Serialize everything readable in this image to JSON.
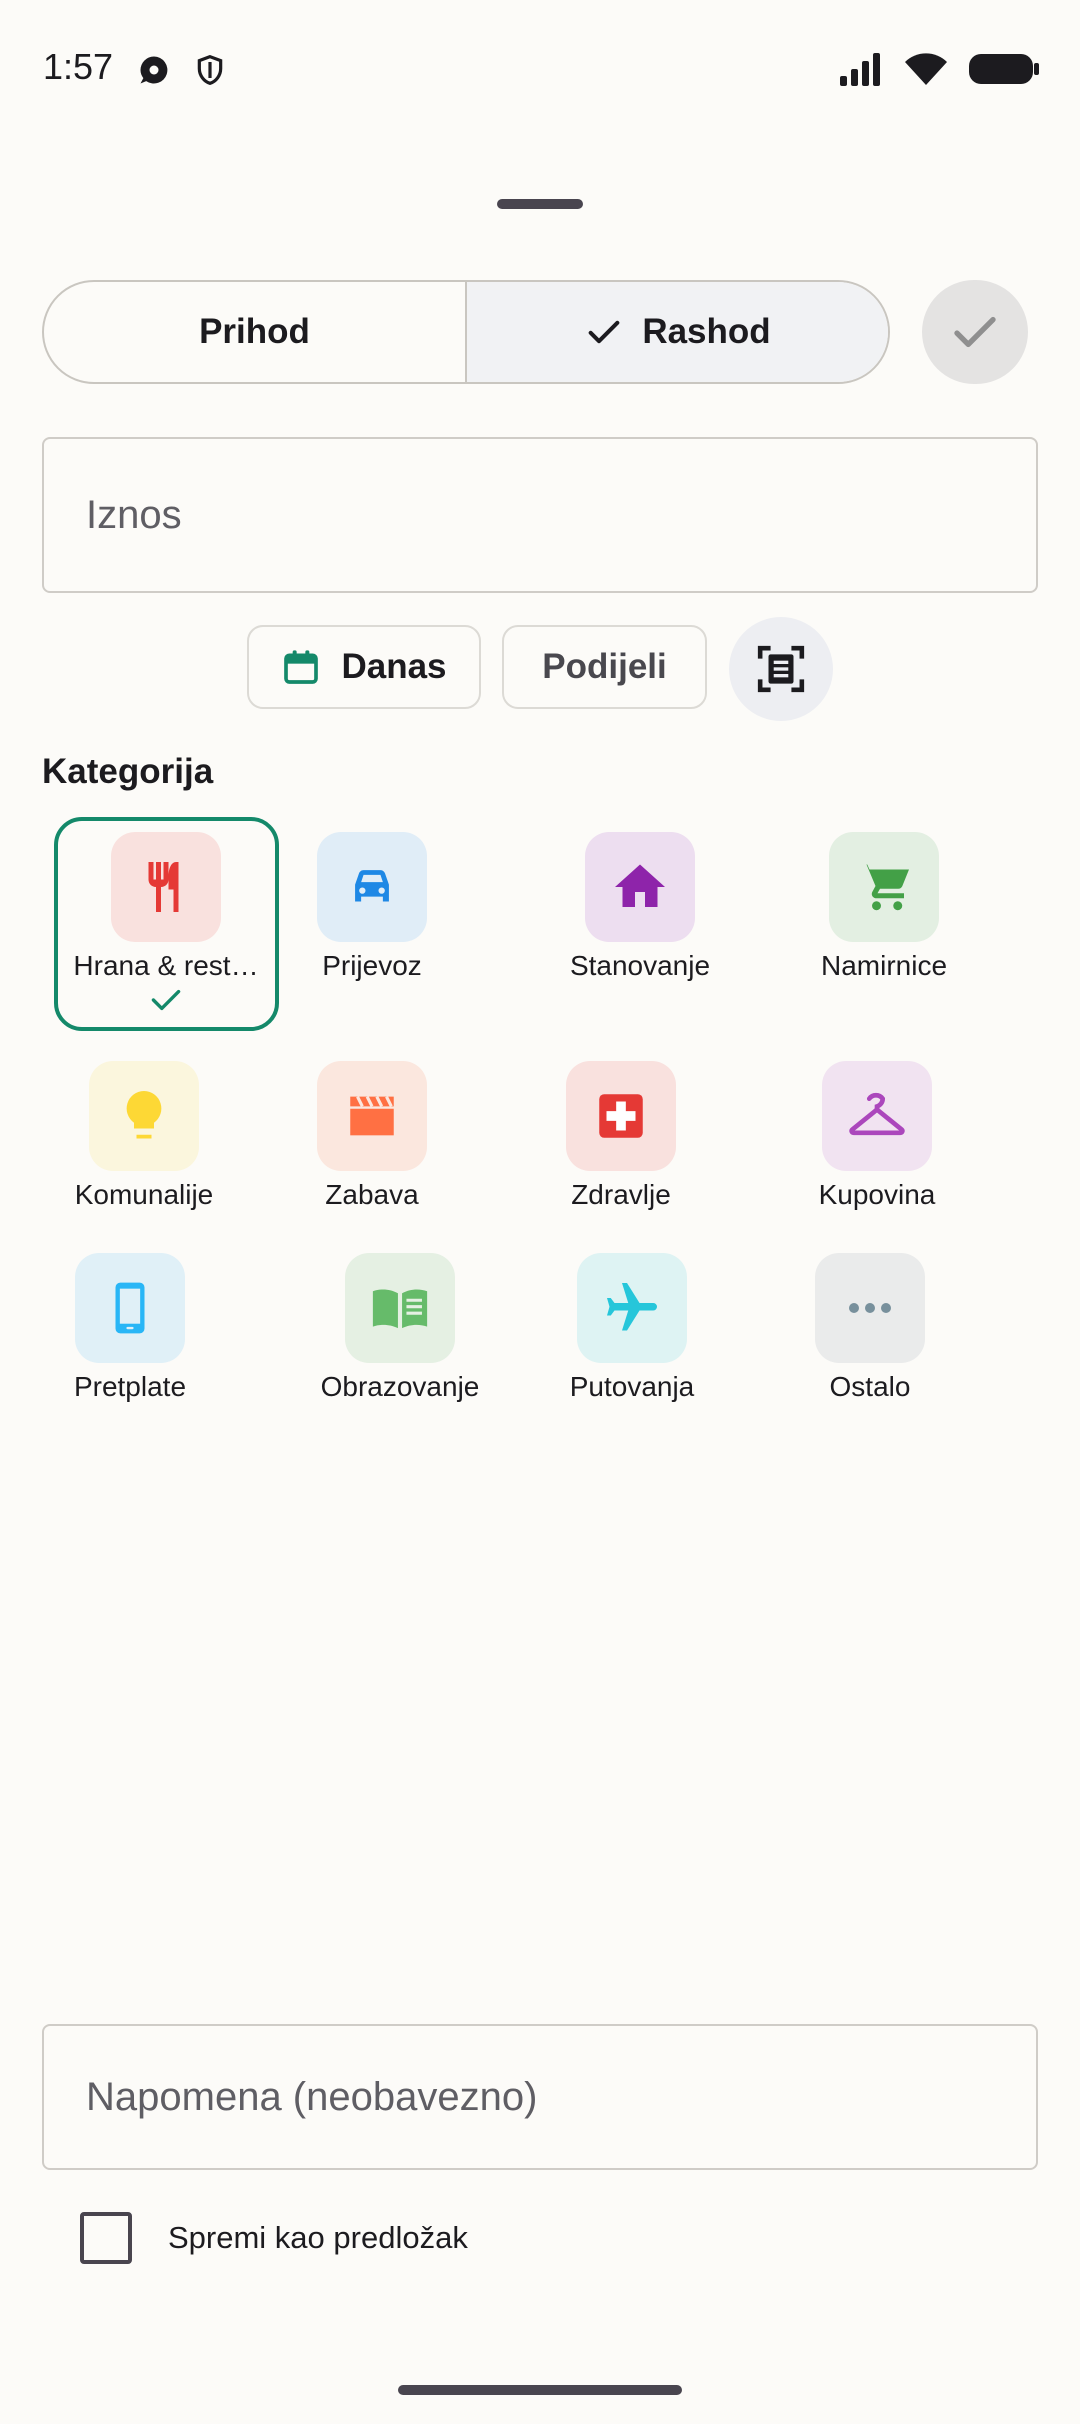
{
  "status_bar": {
    "time": "1:57"
  },
  "type_toggle": {
    "income_label": "Prihod",
    "expense_label": "Rashod",
    "selected": "expense"
  },
  "amount": {
    "placeholder": "Iznos",
    "value": ""
  },
  "chips": {
    "date_label": "Danas",
    "split_label": "Podijeli"
  },
  "category_section": {
    "title": "Kategorija",
    "selected": "Hrana & rest…",
    "items": [
      {
        "label": "Hrana & rest…",
        "icon": "restaurant-icon",
        "color": "#e53935",
        "bg": "#f9e1de"
      },
      {
        "label": "Prijevoz",
        "icon": "car-icon",
        "color": "#1e88e5",
        "bg": "#e0edf7"
      },
      {
        "label": "Stanovanje",
        "icon": "home-icon",
        "color": "#8e24aa",
        "bg": "#eddef0"
      },
      {
        "label": "Namirnice",
        "icon": "cart-icon",
        "color": "#43a047",
        "bg": "#e3efe2"
      },
      {
        "label": "Komunalije",
        "icon": "lightbulb-icon",
        "color": "#fdd835",
        "bg": "#fbf6dd"
      },
      {
        "label": "Zabava",
        "icon": "clapperboard-icon",
        "color": "#ff7043",
        "bg": "#fbe7de"
      },
      {
        "label": "Zdravlje",
        "icon": "medical-cross-icon",
        "color": "#e53935",
        "bg": "#f9e1de"
      },
      {
        "label": "Kupovina",
        "icon": "hanger-icon",
        "color": "#ab47bc",
        "bg": "#f1e3f1"
      },
      {
        "label": "Pretplate",
        "icon": "smartphone-icon",
        "color": "#29b6f6",
        "bg": "#e0f0f7"
      },
      {
        "label": "Obrazovanje",
        "icon": "book-icon",
        "color": "#66bb6a",
        "bg": "#e5f0e3"
      },
      {
        "label": "Putovanja",
        "icon": "airplane-icon",
        "color": "#26c6da",
        "bg": "#def3f3"
      },
      {
        "label": "Ostalo",
        "icon": "more-icon",
        "color": "#78909c",
        "bg": "#eaebeb"
      }
    ]
  },
  "note": {
    "placeholder": "Napomena (neobavezno)",
    "value": ""
  },
  "template_checkbox": {
    "label": "Spremi kao predložak",
    "checked": false
  },
  "colors": {
    "accent": "#14896a",
    "background": "#fcfbf8"
  }
}
